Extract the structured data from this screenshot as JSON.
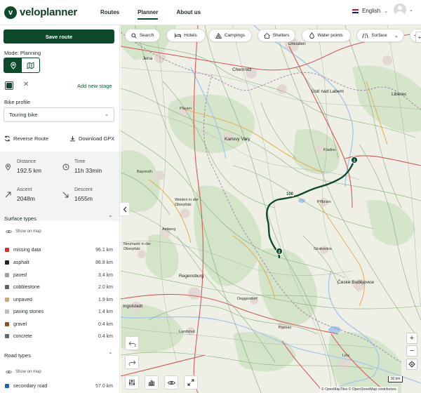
{
  "app": {
    "logo_text": "veloplanner",
    "logo_mark": "v",
    "nav": [
      "Routes",
      "Planner",
      "About us"
    ],
    "active_nav": "Planner",
    "language": "English"
  },
  "sidebar": {
    "save_button": "Save route",
    "mode_label": "Mode: Planning",
    "stage_color": "#0d4a2c",
    "add_stage": "Add new stage",
    "bike_profile_label": "Bike profile",
    "bike_profile_value": "Touring bike",
    "reverse_route": "Reverse Route",
    "download_gpx": "Download GPX",
    "stats": {
      "distance_label": "Distance",
      "distance_value": "192.5 km",
      "time_label": "Time",
      "time_value": "11h 33min",
      "ascent_label": "Ascent",
      "ascent_value": "2048m",
      "descent_label": "Descent",
      "descent_value": "1655m"
    },
    "surface_title": "Surface types",
    "show_on_map": "Show on map",
    "surface_types": [
      {
        "name": "missing data",
        "distance": "96.1 km",
        "color": "#d32f2f"
      },
      {
        "name": "asphalt",
        "distance": "86.8 km",
        "color": "#222222"
      },
      {
        "name": "paved",
        "distance": "3.4 km",
        "color": "#9e9e9e"
      },
      {
        "name": "cobblestone",
        "distance": "2.0 km",
        "color": "#616161"
      },
      {
        "name": "unpaved",
        "distance": "1.9 km",
        "color": "#c9a87c"
      },
      {
        "name": "paving stones",
        "distance": "1.4 km",
        "color": "#b9bfbc"
      },
      {
        "name": "gravel",
        "distance": "0.4 km",
        "color": "#8d4e1f"
      },
      {
        "name": "concrete",
        "distance": "0.4 km",
        "color": "#5c6b73"
      }
    ],
    "road_title": "Road types",
    "road_types": [
      {
        "name": "secondary road",
        "distance": "57.0 km",
        "color": "#1565c0"
      }
    ]
  },
  "map": {
    "chips": [
      "Search",
      "Hotels",
      "Campings",
      "Shelters",
      "Water points",
      "Surface"
    ],
    "route_color": "#0d4a2c",
    "km_marker": "100",
    "waypoints": [
      "1",
      "2"
    ],
    "places": [
      "Jena",
      "Dresden",
      "Chemnitz",
      "Liberec",
      "Ústí nad Labem",
      "Plauen",
      "Karlovy Vary",
      "Kladno",
      "Bayreuth",
      "Weiden in der Oberpfalz",
      "Příbram",
      "Amberg",
      "Neumarkt in der Oberpfalz",
      "Strakonice",
      "Regensburg",
      "České Budějovice",
      "Ingolstadt",
      "Deggendorf",
      "Landshut",
      "Passau",
      "Linz"
    ],
    "scale": "30 km",
    "attribution": "© OpenMapTiles © OpenStreetMap contributors"
  }
}
